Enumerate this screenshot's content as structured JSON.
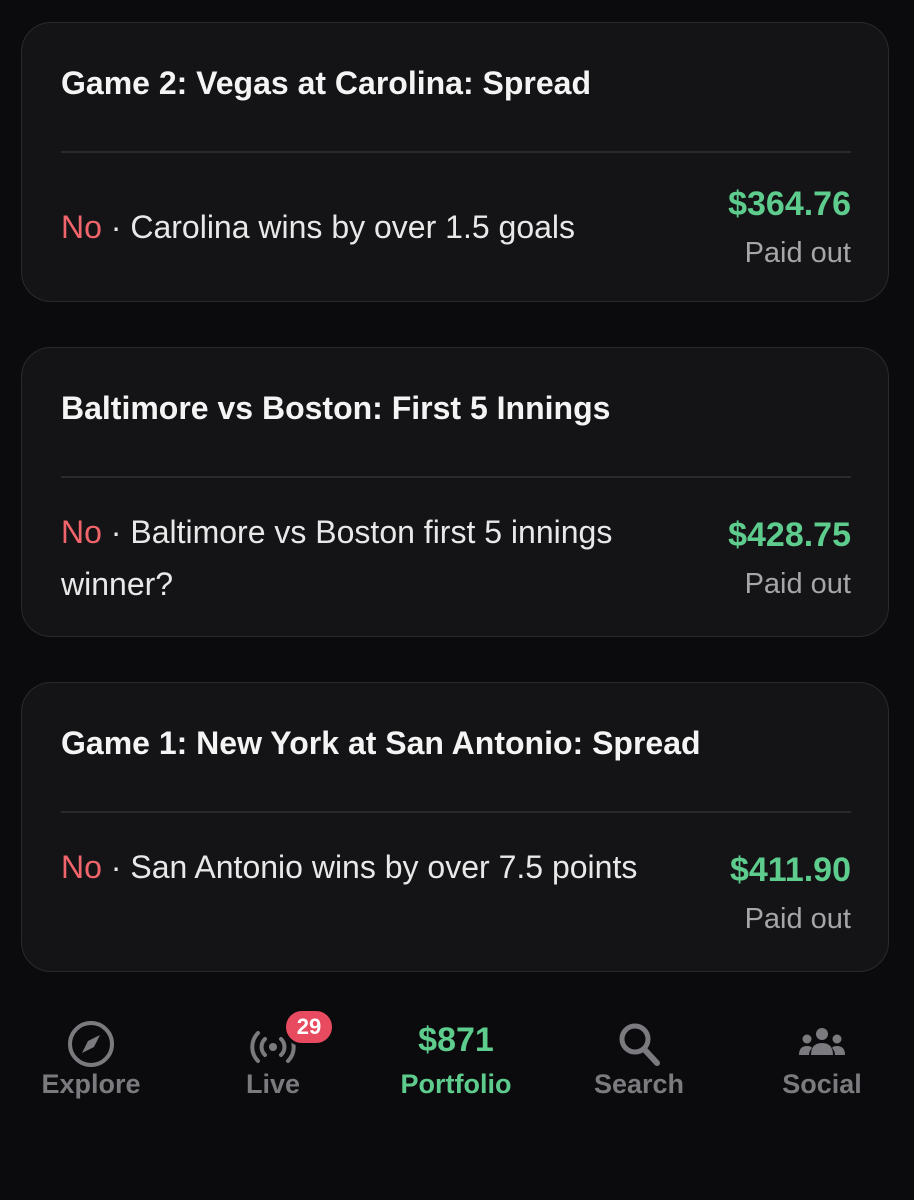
{
  "positions": [
    {
      "title": "Game 2: Vegas at Carolina: Spread",
      "side": "No",
      "separator": "·",
      "description": "Carolina wins by over 1.5 goals",
      "amount": "$364.76",
      "status": "Paid out"
    },
    {
      "title": "Baltimore vs Boston: First 5 Innings",
      "side": "No",
      "separator": "·",
      "description": "Baltimore vs Boston first 5 innings winner?",
      "amount": "$428.75",
      "status": "Paid out"
    },
    {
      "title": "Game 1: New York at San Antonio: Spread",
      "side": "No",
      "separator": "·",
      "description": "San Antonio wins by over 7.5 points",
      "amount": "$411.90",
      "status": "Paid out"
    }
  ],
  "nav": {
    "explore": {
      "label": "Explore",
      "icon": "compass-icon"
    },
    "live": {
      "label": "Live",
      "icon": "broadcast-icon",
      "badge": "29"
    },
    "portfolio": {
      "label": "Portfolio",
      "value": "$871"
    },
    "search": {
      "label": "Search",
      "icon": "search-icon"
    },
    "social": {
      "label": "Social",
      "icon": "people-icon"
    }
  },
  "colors": {
    "background": "#0b0b0d",
    "card": "#141416",
    "accent_green": "#5dcc8d",
    "no_red": "#f0646b",
    "badge_red": "#e84a5f",
    "muted": "#7b7b7f"
  }
}
